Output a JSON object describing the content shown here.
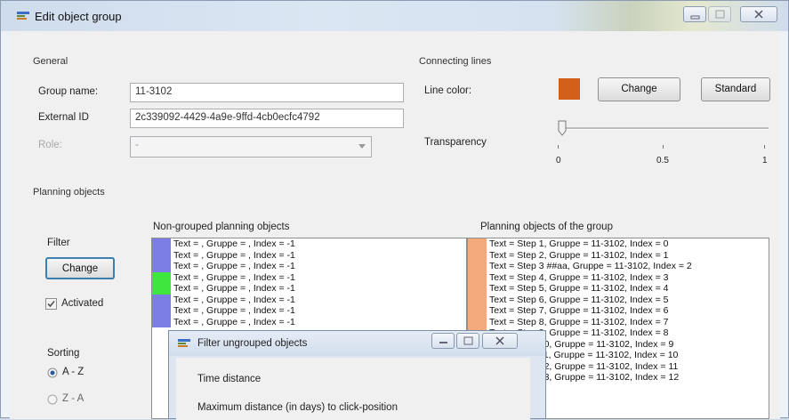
{
  "window": {
    "title": "Edit object group"
  },
  "general": {
    "title": "General",
    "group_name_label": "Group name:",
    "group_name_value": "11-3102",
    "external_id_label": "External ID",
    "external_id_value": "2c339092-4429-4a9e-9ffd-4cb0ecfc4792",
    "role_label": "Role:",
    "role_value": "-"
  },
  "connecting_lines": {
    "title": "Connecting lines",
    "line_color_label": "Line color:",
    "line_color": "#d2601a",
    "change_label": "Change",
    "standard_label": "Standard",
    "transparency_label": "Transparency",
    "transparency_value": 0,
    "ticks": [
      "0",
      "0.5",
      "1"
    ]
  },
  "planning": {
    "title": "Planning objects",
    "filter_label": "Filter",
    "filter_change_label": "Change",
    "activated_label": "Activated",
    "activated_checked": true,
    "sorting_label": "Sorting",
    "sort_az": "A - Z",
    "sort_za": "Z - A",
    "sort_selected": "A - Z",
    "nongrouped_title": "Non-grouped planning objects",
    "group_title": "Planning objects of the group",
    "nongrouped_items": [
      {
        "text": "Text = , Gruppe = , Index = -1",
        "color": "#7d7de6"
      },
      {
        "text": "Text = , Gruppe = , Index = -1",
        "color": "#7d7de6"
      },
      {
        "text": "Text = , Gruppe = , Index = -1",
        "color": "#7d7de6"
      },
      {
        "text": "Text = , Gruppe = , Index = -1",
        "color": "#3ee63e"
      },
      {
        "text": "Text = , Gruppe = , Index = -1",
        "color": "#3ee63e"
      },
      {
        "text": "Text = , Gruppe = , Index = -1",
        "color": "#7d7de6"
      },
      {
        "text": "Text = , Gruppe = , Index = -1",
        "color": "#7d7de6"
      },
      {
        "text": "Text = , Gruppe = , Index = -1",
        "color": "#7d7de6"
      }
    ],
    "group_items": [
      {
        "text": "Text = Step 1, Gruppe = 11-3102, Index = 0",
        "color": "#f2a97c"
      },
      {
        "text": "Text = Step 2, Gruppe = 11-3102, Index = 1",
        "color": "#f2a97c"
      },
      {
        "text": "Text = Step 3 ##aa, Gruppe = 11-3102, Index = 2",
        "color": "#f2a97c"
      },
      {
        "text": "Text = Step 4, Gruppe = 11-3102, Index = 3",
        "color": "#f2a97c"
      },
      {
        "text": "Text = Step 5, Gruppe = 11-3102, Index = 4",
        "color": "#f2a97c"
      },
      {
        "text": "Text = Step 6, Gruppe = 11-3102, Index = 5",
        "color": "#f2a97c"
      },
      {
        "text": "Text = Step 7, Gruppe = 11-3102, Index = 6",
        "color": "#f2a97c"
      },
      {
        "text": "Text = Step 8, Gruppe = 11-3102, Index = 7",
        "color": "#f2a97c"
      },
      {
        "text": "Text = Step 9, Gruppe = 11-3102, Index = 8",
        "color": "#f2a97c"
      },
      {
        "text": "Text = Step 10, Gruppe = 11-3102, Index = 9",
        "color": "#f2a97c"
      },
      {
        "text": "Text = Step 11, Gruppe = 11-3102, Index = 10",
        "color": "#f2a97c"
      },
      {
        "text": "Text = Step 12, Gruppe = 11-3102, Index = 11",
        "color": "#f2a97c"
      },
      {
        "text": "Text = Step 13, Gruppe = 11-3102, Index = 12",
        "color": "#f2a97c"
      }
    ]
  },
  "filter_dialog": {
    "title": "Filter ungrouped objects",
    "section_label": "Time distance",
    "max_distance_label": "Maximum distance (in days) to click-position"
  }
}
